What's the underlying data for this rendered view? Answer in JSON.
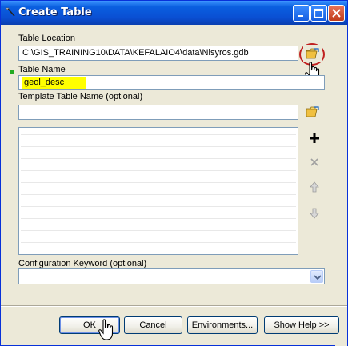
{
  "window": {
    "title": "Create Table",
    "accent": "#0a4fd3"
  },
  "fields": {
    "table_location": {
      "label": "Table Location",
      "value": "C:\\GIS_TRAINING10\\DATA\\KEFALAIO4\\data\\Nisyros.gdb"
    },
    "table_name": {
      "label": "Table Name",
      "value": "geol_desc",
      "required_indicator_color": "#22aa22",
      "highlight_color": "#ffff00"
    },
    "template_table": {
      "label": "Template Table Name (optional)",
      "value": ""
    },
    "config_keyword": {
      "label": "Configuration Keyword (optional)",
      "value": ""
    }
  },
  "list_toolbar": {
    "add_icon": "plus-icon",
    "remove_icon": "x-icon",
    "up_icon": "arrow-up-icon",
    "down_icon": "arrow-down-icon"
  },
  "buttons": {
    "ok": "OK",
    "cancel": "Cancel",
    "environments": "Environments...",
    "show_help": "Show Help >>"
  }
}
